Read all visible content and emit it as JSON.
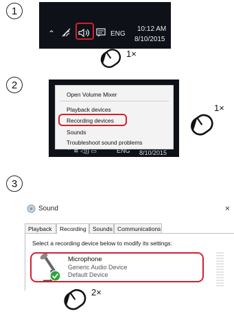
{
  "steps": [
    {
      "number": "1",
      "clicks": "1×"
    },
    {
      "number": "2",
      "clicks": "1×"
    },
    {
      "number": "3",
      "clicks": "2×"
    }
  ],
  "taskbar": {
    "time": "10:12 AM",
    "date": "8/10/2015",
    "language": "ENG",
    "icons": [
      "chevron-up-icon",
      "wifi-icon",
      "speaker-icon",
      "action-center-icon"
    ]
  },
  "context_menu": {
    "items": [
      "Open Volume Mixer",
      "Playback devices",
      "Recording devices",
      "Sounds",
      "Troubleshoot sound problems"
    ],
    "highlighted": "Recording devices",
    "taskbar_date": "8/10/2015",
    "taskbar_language": "ENG"
  },
  "sound_dialog": {
    "title": "Sound",
    "close": "×",
    "tabs": [
      "Playback",
      "Recording",
      "Sounds",
      "Communications"
    ],
    "active_tab": "Recording",
    "instruction": "Select a recording device below to modify its settings:",
    "device": {
      "name": "Microphone",
      "lines": [
        "Generic Audio Device",
        "Default Device"
      ]
    }
  },
  "colors": {
    "highlight": "#d0202d",
    "taskbar": "#0e1218"
  }
}
